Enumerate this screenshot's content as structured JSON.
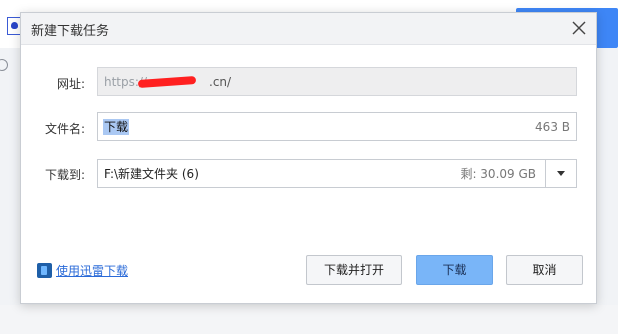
{
  "dialog": {
    "title": "新建下载任务",
    "url_label": "网址:",
    "url_value": "https://",
    "url_suffix": ".cn/",
    "filename_label": "文件名:",
    "filename_value": "下载",
    "file_size": "463 B",
    "saveto_label": "下载到:",
    "saveto_value": "F:\\新建文件夹 (6)",
    "free_space": "剩: 30.09 GB",
    "thunder_link": "使用迅雷下载",
    "buttons": {
      "download_open": "下载并打开",
      "download": "下载",
      "cancel": "取消"
    }
  },
  "colors": {
    "primary_button": "#79b5f8",
    "link": "#2a6ad8",
    "selection": "#aac8f3"
  }
}
